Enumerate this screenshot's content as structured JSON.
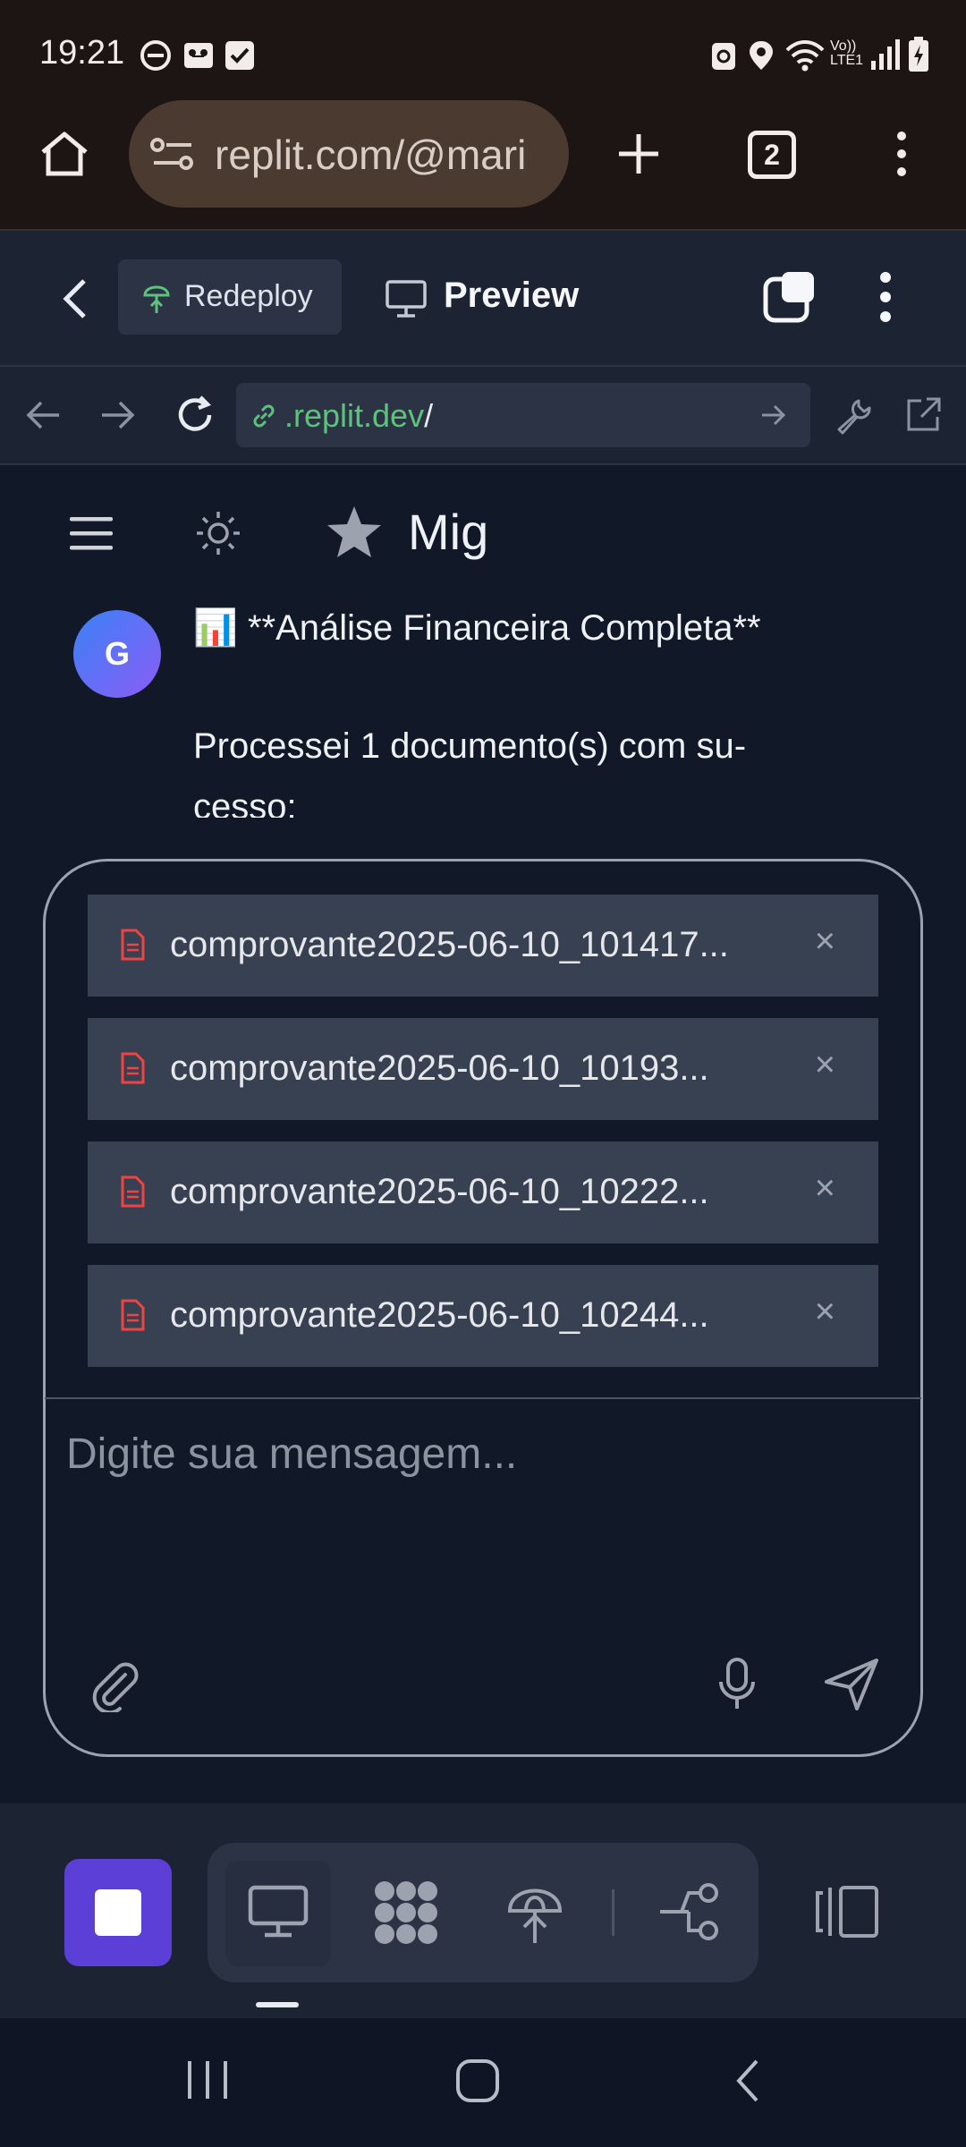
{
  "status_bar": {
    "time": "19:21",
    "icons": [
      "dnd-icon",
      "voicemail-icon",
      "check-icon",
      "recycle-icon",
      "location-icon",
      "wifi-icon",
      "volte-icon",
      "signal-icon",
      "battery-charging-icon"
    ],
    "volte_label": "Vo)) LTE1"
  },
  "browser": {
    "url": "replit.com/@mari",
    "tab_count": "2"
  },
  "replit_header": {
    "redeploy_label": "Redeploy",
    "preview_label": "Preview"
  },
  "webview_nav": {
    "domain": ".replit.dev",
    "path": "/"
  },
  "app": {
    "name": "Mig",
    "message": {
      "avatar_initial": "G",
      "title": "**Análise Financeira Completa**",
      "title_emoji": "📊",
      "body_line1": "Processei 1 documento(s) com su-",
      "body_line2": "cesso:"
    },
    "attachments": [
      {
        "name": "comprovante2025-06-10_101417..."
      },
      {
        "name": "comprovante2025-06-10_10193..."
      },
      {
        "name": "comprovante2025-06-10_10222..."
      },
      {
        "name": "comprovante2025-06-10_10244..."
      }
    ],
    "remove_symbol": "×",
    "input_placeholder": "Digite sua mensagem..."
  },
  "colors": {
    "accent_purple": "#5b3fd6",
    "link_green": "#5fc27c",
    "file_icon_red": "#ef4444"
  }
}
